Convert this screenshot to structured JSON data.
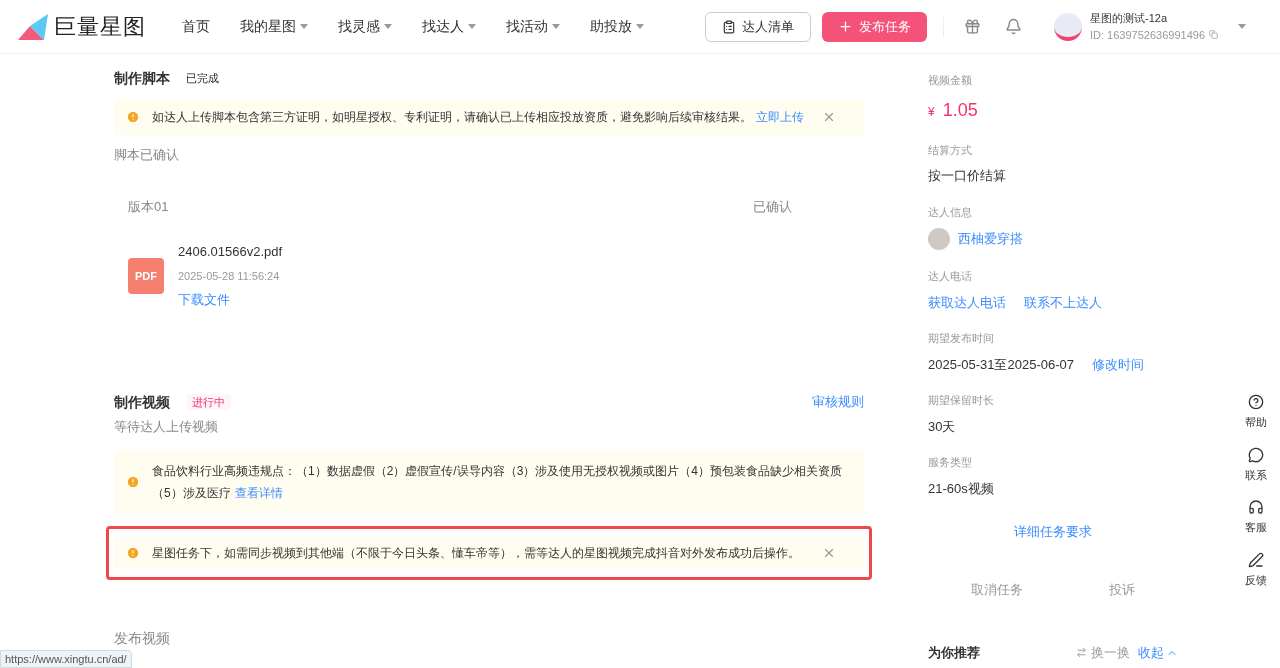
{
  "header": {
    "logo_text": "巨量星图",
    "nav": [
      {
        "label": "首页",
        "dropdown": false
      },
      {
        "label": "我的星图",
        "dropdown": true
      },
      {
        "label": "找灵感",
        "dropdown": true
      },
      {
        "label": "找达人",
        "dropdown": true
      },
      {
        "label": "找活动",
        "dropdown": true
      },
      {
        "label": "助投放",
        "dropdown": true
      }
    ],
    "list_button": "达人清单",
    "publish_button": "发布任务",
    "user": {
      "name": "星图的测试-12a",
      "id": "ID: 1639752636991496"
    }
  },
  "script_section": {
    "title": "制作脚本",
    "status": "已完成",
    "notice": {
      "text": "如达人上传脚本包含第三方证明，如明星授权、专利证明，请确认已上传相应投放资质，避免影响后续审核结果。",
      "link": "立即上传",
      "closable": true
    },
    "subtitle": "脚本已确认",
    "version": {
      "label": "版本01",
      "status": "已确认",
      "file_name": "2406.01566v2.pdf",
      "file_badge": "PDF",
      "time": "2025-05-28 11:56:24",
      "download": "下载文件"
    }
  },
  "video_section": {
    "title": "制作视频",
    "status": "进行中",
    "rules_link": "审核规则",
    "subtitle": "等待达人上传视频",
    "notices": [
      {
        "text": "食品饮料行业高频违规点：（1）数据虚假（2）虚假宣传/误导内容（3）涉及使用无授权视频或图片（4）预包装食品缺少相关资质（5）涉及医疗",
        "link": "查看详情",
        "closable": false,
        "highlighted": false
      },
      {
        "text": "星图任务下，如需同步视频到其他端（不限于今日头条、懂车帝等），需等达人的星图视频完成抖音对外发布成功后操作。",
        "closable": true,
        "highlighted": true
      }
    ]
  },
  "publish_section": {
    "title": "发布视频"
  },
  "sidebar": {
    "fields": [
      {
        "kind": "price",
        "label": "视频金额",
        "currency": "¥",
        "value": "1.05"
      },
      {
        "kind": "text",
        "label": "结算方式",
        "value": "按一口价结算"
      },
      {
        "kind": "creator",
        "label": "达人信息",
        "value": "西柚爱穿搭"
      },
      {
        "kind": "links",
        "label": "达人电话",
        "links": [
          "获取达人电话",
          "联系不上达人"
        ]
      },
      {
        "kind": "text_link",
        "label": "期望发布时间",
        "value": "2025-05-31至2025-06-07",
        "link": "修改时间"
      },
      {
        "kind": "text",
        "label": "期望保留时长",
        "value": "30天"
      },
      {
        "kind": "text",
        "label": "服务类型",
        "value": "21-60s视频"
      }
    ],
    "detail_link": "详细任务要求",
    "actions": [
      "取消任务",
      "投诉"
    ],
    "recommend": {
      "title": "为你推荐",
      "shuffle": "换一换",
      "collapse": "收起"
    }
  },
  "float_toolbar": [
    {
      "kind": "help",
      "label": "帮助"
    },
    {
      "kind": "chat",
      "label": "联系"
    },
    {
      "kind": "headset",
      "label": "客服"
    },
    {
      "kind": "edit",
      "label": "反馈"
    }
  ],
  "status_url": "https://www.xingtu.cn/ad/"
}
